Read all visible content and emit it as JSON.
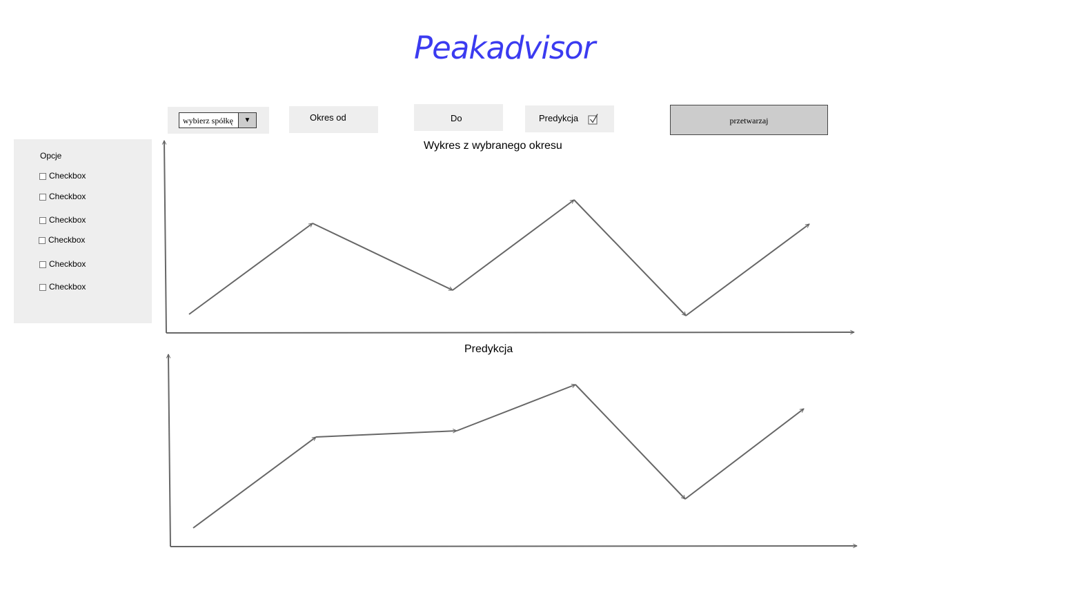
{
  "app": {
    "title": "Peakadvisor"
  },
  "controls": {
    "company_select": {
      "value": "wybierz spółkę"
    },
    "period_from_label": "Okres od",
    "period_to_label": "Do",
    "prediction_label": "Predykcja",
    "prediction_checked": true,
    "process_label": "przetwarzaj"
  },
  "sidebar": {
    "title": "Opcje",
    "items": [
      {
        "label": "Checkbox",
        "checked": false
      },
      {
        "label": "Checkbox",
        "checked": false
      },
      {
        "label": "Checkbox",
        "checked": false
      },
      {
        "label": "Checkbox",
        "checked": false
      },
      {
        "label": "Checkbox",
        "checked": false
      },
      {
        "label": "Checkbox",
        "checked": false
      }
    ]
  },
  "charts": {
    "period": {
      "title": "Wykres z wybranego okresu"
    },
    "prediction": {
      "title": "Predykcja"
    }
  },
  "colors": {
    "title": "#3b3bf0",
    "line": "#666666",
    "panel": "#eeeeee"
  }
}
